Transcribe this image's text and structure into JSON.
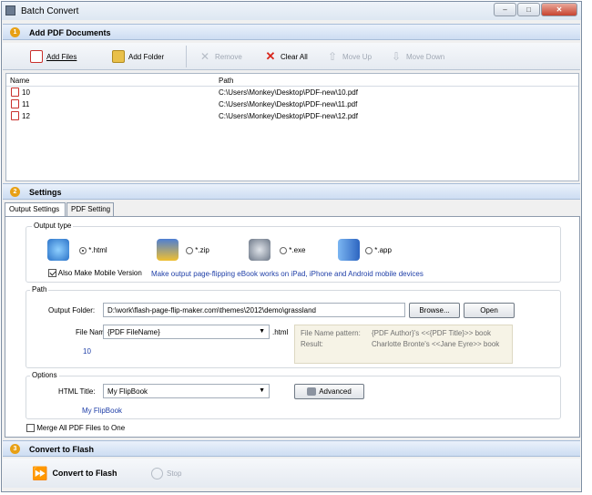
{
  "window": {
    "title": "Batch Convert",
    "minimize": "–",
    "maximize": "□",
    "close": "✕"
  },
  "sections": [
    {
      "num": "1",
      "label": "Add PDF Documents"
    },
    {
      "num": "2",
      "label": "Settings"
    },
    {
      "num": "3",
      "label": "Convert to Flash"
    }
  ],
  "toolbar": {
    "add_files": "Add Files",
    "add_folder": "Add Folder",
    "remove": "Remove",
    "clear_all": "Clear All",
    "move_up": "Move Up",
    "move_down": "Move Down"
  },
  "file_list": {
    "columns": [
      "Name",
      "Path"
    ],
    "rows": [
      {
        "name": "10",
        "path": "C:\\Users\\Monkey\\Desktop\\PDF-new\\10.pdf"
      },
      {
        "name": "11",
        "path": "C:\\Users\\Monkey\\Desktop\\PDF-new\\11.pdf"
      },
      {
        "name": "12",
        "path": "C:\\Users\\Monkey\\Desktop\\PDF-new\\12.pdf"
      }
    ]
  },
  "tabs": [
    "Output Settings",
    "PDF Setting"
  ],
  "output_type": {
    "label": "Output type",
    "options": [
      "*.html",
      "*.zip",
      "*.exe",
      "*.app"
    ],
    "selected": "*.html",
    "mobile_label": "Also Make Mobile Version",
    "mobile_desc": "Make output page-flipping eBook works on iPad, iPhone and Android mobile devices"
  },
  "path": {
    "label": "Path",
    "output_folder_label": "Output Folder:",
    "output_folder_value": "D:\\work\\flash-page-flip-maker.com\\themes\\2012\\demo\\grassland",
    "browse": "Browse...",
    "open": "Open",
    "file_name_label": "File Name:",
    "file_name_value": "{PDF FileName}",
    "file_ext": ".html",
    "preview": "10",
    "pattern_label": "File Name pattern:",
    "pattern_value": "{PDF Author}'s <<{PDF Title}>> book",
    "result_label": "Result:",
    "result_value": "Charlotte Bronte's <<Jane Eyre>> book"
  },
  "options": {
    "label": "Options",
    "html_title_label": "HTML Title:",
    "html_title_value": "My FlipBook",
    "html_title_preview": "My FlipBook",
    "advanced": "Advanced"
  },
  "merge_label": "Merge All PDF Files to One",
  "footer": {
    "convert": "Convert to Flash",
    "stop": "Stop"
  }
}
